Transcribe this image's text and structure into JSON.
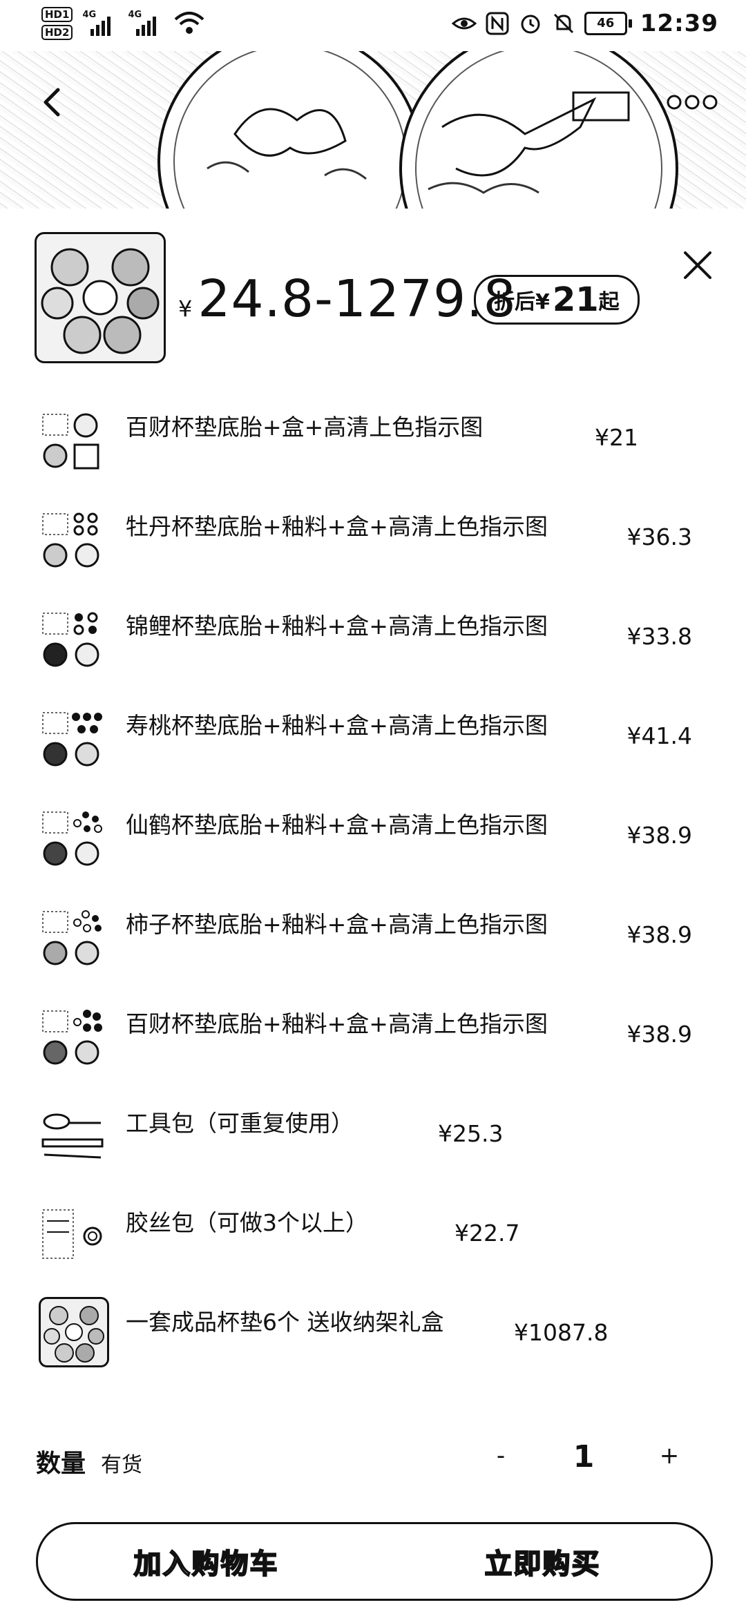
{
  "status_bar": {
    "hd1": "HD1",
    "hd2": "HD2",
    "net1": "4G",
    "net2": "4G",
    "battery": "46",
    "time": "12:39"
  },
  "banner": {
    "back_icon": "chevron-left-icon",
    "more_icon": "more-dots-icon"
  },
  "product": {
    "price_currency": "¥",
    "price_range": "24.8-1279.8",
    "discount_prefix": "折后¥",
    "discount_value": "21",
    "discount_suffix": "起",
    "close_icon": "close-icon"
  },
  "skus": [
    {
      "name": "百财杯垫底胎+盒+高清上色指示图",
      "price": "¥21"
    },
    {
      "name": "牡丹杯垫底胎+釉料+盒+高清上色指示图",
      "price": "¥36.3"
    },
    {
      "name": "锦鲤杯垫底胎+釉料+盒+高清上色指示图",
      "price": "¥33.8"
    },
    {
      "name": "寿桃杯垫底胎+釉料+盒+高清上色指示图",
      "price": "¥41.4"
    },
    {
      "name": "仙鹤杯垫底胎+釉料+盒+高清上色指示图",
      "price": "¥38.9"
    },
    {
      "name": "柿子杯垫底胎+釉料+盒+高清上色指示图",
      "price": "¥38.9"
    },
    {
      "name": "百财杯垫底胎+釉料+盒+高清上色指示图",
      "price": "¥38.9"
    },
    {
      "name": "工具包（可重复使用）",
      "price": "¥25.3"
    },
    {
      "name": "胶丝包（可做3个以上）",
      "price": "¥22.7"
    },
    {
      "name": "一套成品杯垫6个 送收纳架礼盒",
      "price": "¥1087.8"
    }
  ],
  "quantity": {
    "label": "数量",
    "stock": "有货",
    "minus": "-",
    "value": "1",
    "plus": "+"
  },
  "actions": {
    "add_to_cart": "加入购物车",
    "buy_now": "立即购买"
  }
}
